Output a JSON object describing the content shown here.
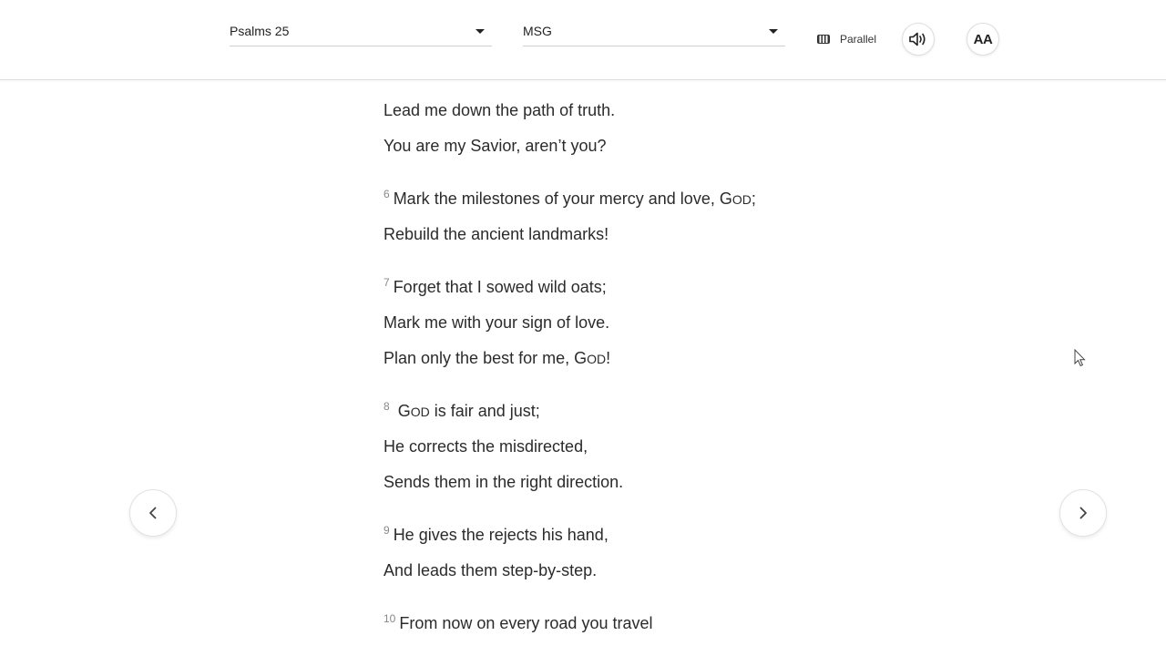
{
  "header": {
    "book_select": {
      "value": "Psalms 25"
    },
    "version_select": {
      "value": "MSG"
    },
    "parallel_label": "Parallel",
    "font_button_label": "AA"
  },
  "verses": [
    {
      "lines": [
        {
          "text": "Lead me down the path of truth."
        },
        {
          "text": "You are my Savior, aren’t you?"
        }
      ]
    },
    {
      "number": "6",
      "lines": [
        {
          "pre": "Mark the milestones of your mercy and love, G",
          "sc": "od",
          "post": ";"
        },
        {
          "text": "Rebuild the ancient landmarks!"
        }
      ]
    },
    {
      "number": "7",
      "lines": [
        {
          "text": "Forget that I sowed wild oats;"
        },
        {
          "text": "Mark me with your sign of love."
        },
        {
          "pre": "Plan only the best for me, G",
          "sc": "od",
          "post": "!"
        }
      ]
    },
    {
      "number": "8",
      "lines": [
        {
          "pre": " G",
          "sc": "od",
          "post": " is fair and just;"
        },
        {
          "text": "He corrects the misdirected,"
        },
        {
          "text": "Sends them in the right direction."
        }
      ]
    },
    {
      "number": "9",
      "lines": [
        {
          "text": "He gives the rejects his hand,"
        },
        {
          "text": "And leads them step-by-step."
        }
      ]
    },
    {
      "number": "10",
      "lines": [
        {
          "text": "From now on every road you travel"
        }
      ]
    }
  ],
  "icons": {
    "book_caret": "chevron-down-icon",
    "version_caret": "chevron-down-icon",
    "parallel": "parallel-columns-icon",
    "audio": "speaker-icon",
    "prev": "chevron-left-icon",
    "next": "chevron-right-icon"
  },
  "colors": {
    "text": "#2b2b2b",
    "verse_number": "#888888",
    "divider": "#dcdcdc",
    "background": "#ffffff"
  }
}
